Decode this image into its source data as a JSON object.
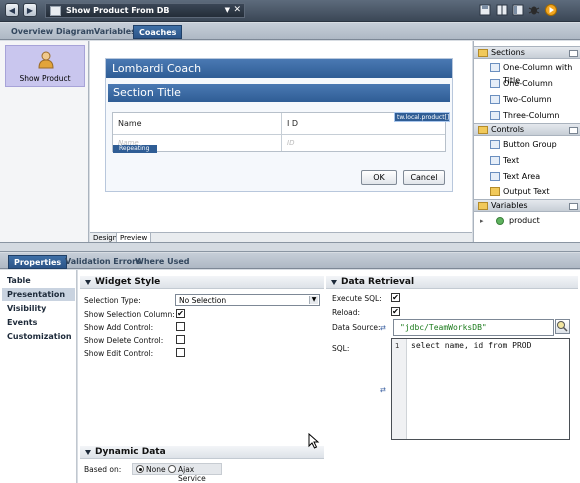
{
  "title_bar": {
    "title": "Show Product From DB",
    "close_glyph": "✕",
    "dropdown_glyph": "▼"
  },
  "editor_tabs": [
    "Overview",
    "Diagram",
    "Variables",
    "Coaches"
  ],
  "coach_list": {
    "item_label": "Show Product"
  },
  "coach": {
    "header": "Lombardi Coach",
    "section_title": "Section Title",
    "binding": "tw.local.product[]",
    "columns": [
      "Name",
      "I D"
    ],
    "placeholders": [
      "Name",
      "ID"
    ],
    "repeating_label": "Repeating",
    "ok_label": "OK",
    "cancel_label": "Cancel"
  },
  "design_tabs": [
    "Design",
    "Preview"
  ],
  "palette": {
    "sections_title": "Sections",
    "sections": [
      "One-Column with Title",
      "One-Column",
      "Two-Column",
      "Three-Column"
    ],
    "controls_title": "Controls",
    "controls": [
      "Button Group",
      "Text",
      "Text Area",
      "Output Text"
    ],
    "variables_title": "Variables",
    "variables": [
      "product"
    ]
  },
  "properties_tabs": [
    "Properties",
    "Validation Errors",
    "Where Used"
  ],
  "properties_nav": [
    "Table",
    "Presentation",
    "Visibility",
    "Events",
    "Customization"
  ],
  "widget_style": {
    "title": "Widget Style",
    "selection_type_label": "Selection Type:",
    "selection_type_value": "No Selection",
    "show_selection_label": "Show Selection Column:",
    "show_add_label": "Show Add Control:",
    "show_delete_label": "Show Delete Control:",
    "show_edit_label": "Show Edit Control:",
    "show_selection_checked": true,
    "show_add_checked": false,
    "show_delete_checked": false,
    "show_edit_checked": false
  },
  "dynamic_data": {
    "title": "Dynamic Data",
    "based_on_label": "Based on:",
    "option_none": "None",
    "option_ajax": "Ajax Service",
    "selected": "None"
  },
  "data_retrieval": {
    "title": "Data Retrieval",
    "execute_sql_label": "Execute SQL:",
    "reload_label": "Reload:",
    "data_source_label": "Data Source:",
    "data_source_value": "\"jdbc/TeamWorksDB\"",
    "sql_label": "SQL:",
    "sql_line_number": "1",
    "sql_value": "select name, id from PROD",
    "execute_sql_checked": true,
    "reload_checked": true
  },
  "colors": {
    "accent": "#2f5d95",
    "selected_coach": "#c9c6ee"
  }
}
